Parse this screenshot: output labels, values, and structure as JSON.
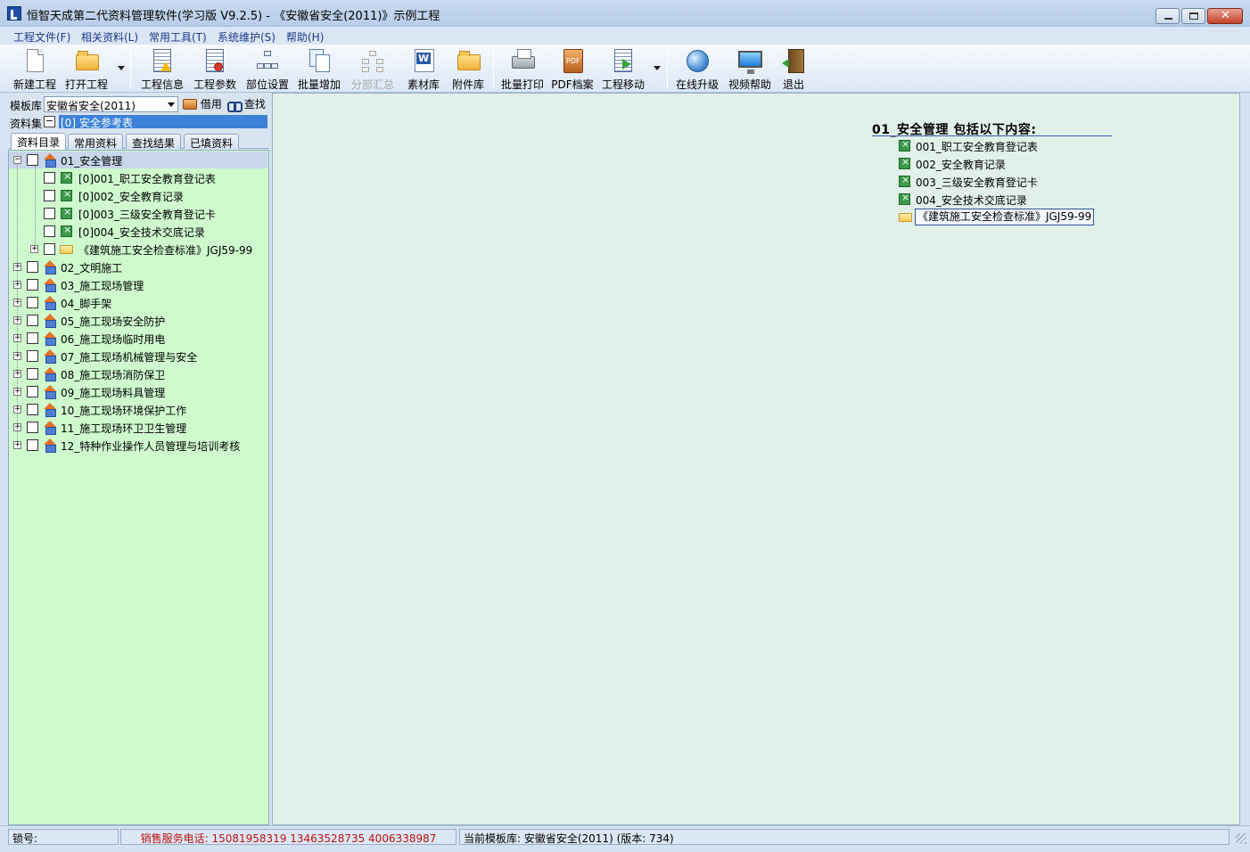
{
  "window": {
    "title": "恒智天成第二代资料管理软件(学习版 V9.2.5) - 《安徽省安全(2011)》示例工程"
  },
  "menu": [
    {
      "label": "工程文件(F)"
    },
    {
      "label": "相关资料(L)"
    },
    {
      "label": "常用工具(T)"
    },
    {
      "label": "系统维护(S)"
    },
    {
      "label": "帮助(H)"
    }
  ],
  "toolbar": [
    {
      "label": "新建工程",
      "icon": "new-doc-icon"
    },
    {
      "label": "打开工程",
      "icon": "open-folder-icon"
    },
    {
      "label": "工程信息",
      "icon": "project-info-icon"
    },
    {
      "label": "工程参数",
      "icon": "project-params-icon"
    },
    {
      "label": "部位设置",
      "icon": "position-settings-icon"
    },
    {
      "label": "批量增加",
      "icon": "batch-add-icon"
    },
    {
      "label": "分部汇总",
      "icon": "summary-icon",
      "disabled": true
    },
    {
      "label": "素材库",
      "icon": "material-library-icon"
    },
    {
      "label": "附件库",
      "icon": "attachment-library-icon"
    },
    {
      "label": "批量打印",
      "icon": "printer-icon"
    },
    {
      "label": "PDF档案",
      "icon": "pdf-icon"
    },
    {
      "label": "工程移动",
      "icon": "move-project-icon"
    },
    {
      "label": "在线升级",
      "icon": "globe-icon"
    },
    {
      "label": "视频帮助",
      "icon": "monitor-icon"
    },
    {
      "label": "退出",
      "icon": "exit-door-icon"
    }
  ],
  "left": {
    "template_label": "模板库",
    "template_value": "安徽省安全(2011)",
    "borrow_label": "借用",
    "find_label": "查找",
    "set_label": "资料集",
    "set_value": "[0] 安全参考表",
    "tabs": [
      {
        "label": "资料目录",
        "active": true
      },
      {
        "label": "常用资料"
      },
      {
        "label": "查找结果"
      },
      {
        "label": "已填资料"
      }
    ],
    "tree": [
      {
        "label": "01_安全管理",
        "level": 0,
        "type": "category",
        "expanded": true,
        "selected": true
      },
      {
        "label": "[0]001_职工安全教育登记表",
        "level": 1,
        "type": "excel"
      },
      {
        "label": "[0]002_安全教育记录",
        "level": 1,
        "type": "excel"
      },
      {
        "label": "[0]003_三级安全教育登记卡",
        "level": 1,
        "type": "excel"
      },
      {
        "label": "[0]004_安全技术交底记录",
        "level": 1,
        "type": "excel"
      },
      {
        "label": "《建筑施工安全检查标准》JGJ59-99",
        "level": 1,
        "type": "folder",
        "expandable": true
      },
      {
        "label": "02_文明施工",
        "level": 0,
        "type": "category"
      },
      {
        "label": "03_施工现场管理",
        "level": 0,
        "type": "category"
      },
      {
        "label": "04_脚手架",
        "level": 0,
        "type": "category"
      },
      {
        "label": "05_施工现场安全防护",
        "level": 0,
        "type": "category"
      },
      {
        "label": "06_施工现场临时用电",
        "level": 0,
        "type": "category"
      },
      {
        "label": "07_施工现场机械管理与安全",
        "level": 0,
        "type": "category"
      },
      {
        "label": "08_施工现场消防保卫",
        "level": 0,
        "type": "category"
      },
      {
        "label": "09_施工现场料具管理",
        "level": 0,
        "type": "category"
      },
      {
        "label": "10_施工现场环境保护工作",
        "level": 0,
        "type": "category"
      },
      {
        "label": "11_施工现场环卫卫生管理",
        "level": 0,
        "type": "category"
      },
      {
        "label": "12_特种作业操作人员管理与培训考核",
        "level": 0,
        "type": "category"
      }
    ]
  },
  "right": {
    "heading": "01_安全管理 包括以下内容:",
    "items": [
      {
        "label": "001_职工安全教育登记表",
        "type": "excel"
      },
      {
        "label": "002_安全教育记录",
        "type": "excel"
      },
      {
        "label": "003_三级安全教育登记卡",
        "type": "excel"
      },
      {
        "label": "004_安全技术交底记录",
        "type": "excel"
      },
      {
        "label": "《建筑施工安全检查标准》JGJ59-99",
        "type": "folder",
        "boxed": true
      }
    ]
  },
  "status": {
    "lock": "锁号:",
    "phone": "销售服务电话: 15081958319 13463528735 4006338987",
    "current": "当前模板库: 安徽省安全(2011) (版本: 734)"
  },
  "colors": {
    "tree_bg": "#ceface",
    "content_bg": "#e2f0ea",
    "phone_text": "#c01010",
    "selection": "#3b82d8"
  }
}
